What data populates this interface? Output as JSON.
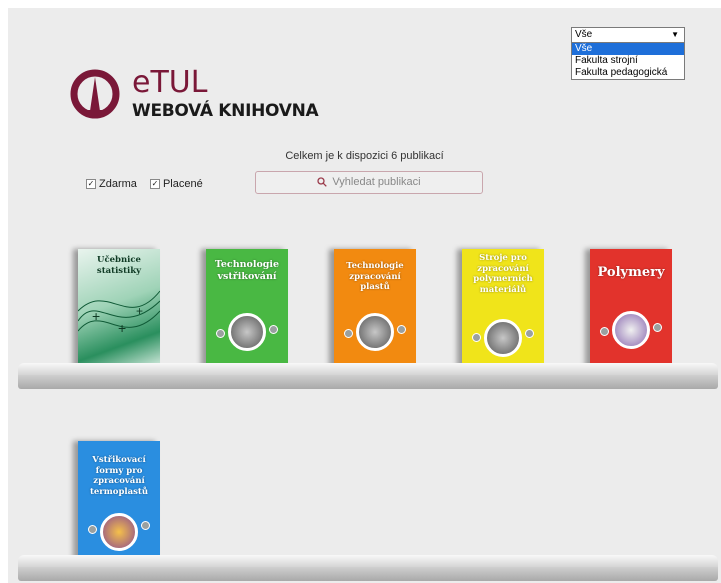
{
  "faculty_select": {
    "selected": "Vše",
    "options": [
      "Vše",
      "Fakulta strojní",
      "Fakulta pedagogická"
    ]
  },
  "logo": {
    "title": "eTUL",
    "subtitle": "WEBOVÁ KNIHOVNA"
  },
  "summary": "Celkem je k dispozici 6 publikací",
  "filters": [
    {
      "label": "Zdarma",
      "checked": true
    },
    {
      "label": "Placené",
      "checked": true
    }
  ],
  "search": {
    "placeholder": "Vyhledat publikaci"
  },
  "books": [
    {
      "title": "Učebnice statistiky",
      "color": "#1e8a55"
    },
    {
      "title": "Technologie vstřikování",
      "color": "#49b843"
    },
    {
      "title": "Technologie zpracování plastů",
      "color": "#f28a10"
    },
    {
      "title": "Stroje pro zpracování polymerních materiálů",
      "color": "#f0e41a"
    },
    {
      "title": "Polymery",
      "color": "#e2332c"
    },
    {
      "title": "Vstřikovací formy pro zpracování termoplastů",
      "color": "#2a8ee0"
    }
  ],
  "colors": {
    "brand": "#7a1838",
    "page_bg": "#ececec"
  }
}
